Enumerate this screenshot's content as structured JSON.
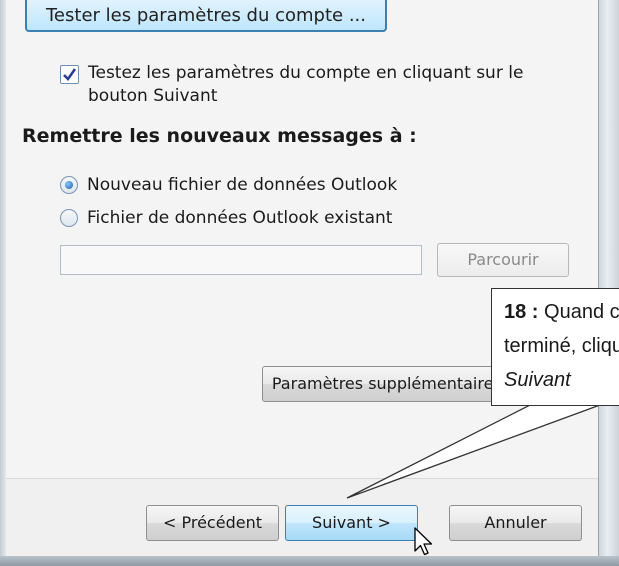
{
  "account_test_button": "Tester les paramètres du compte ...",
  "test_checkbox": {
    "checked": true,
    "label": "Testez les paramètres du compte en cliquant sur le bouton Suivant"
  },
  "deliver_section": {
    "heading": "Remettre les nouveaux messages à :",
    "option_new": "Nouveau fichier de données Outlook",
    "option_existing": "Fichier de données Outlook existant",
    "selected": "option_new",
    "path_value": "",
    "browse_label": "Parcourir"
  },
  "more_settings_label": "Paramètres supplémentaires ...",
  "nav": {
    "back_label": "< Précédent",
    "next_label": "Suivant >",
    "cancel_label": "Annuler"
  },
  "callout": {
    "step": "18 :",
    "line1_rest": " Quand c'est",
    "line2": "terminé, cliquez sur",
    "line3": "Suivant"
  },
  "colors": {
    "focus_border": "#3c7fb1",
    "panel_bg": "#f4f4f4"
  }
}
